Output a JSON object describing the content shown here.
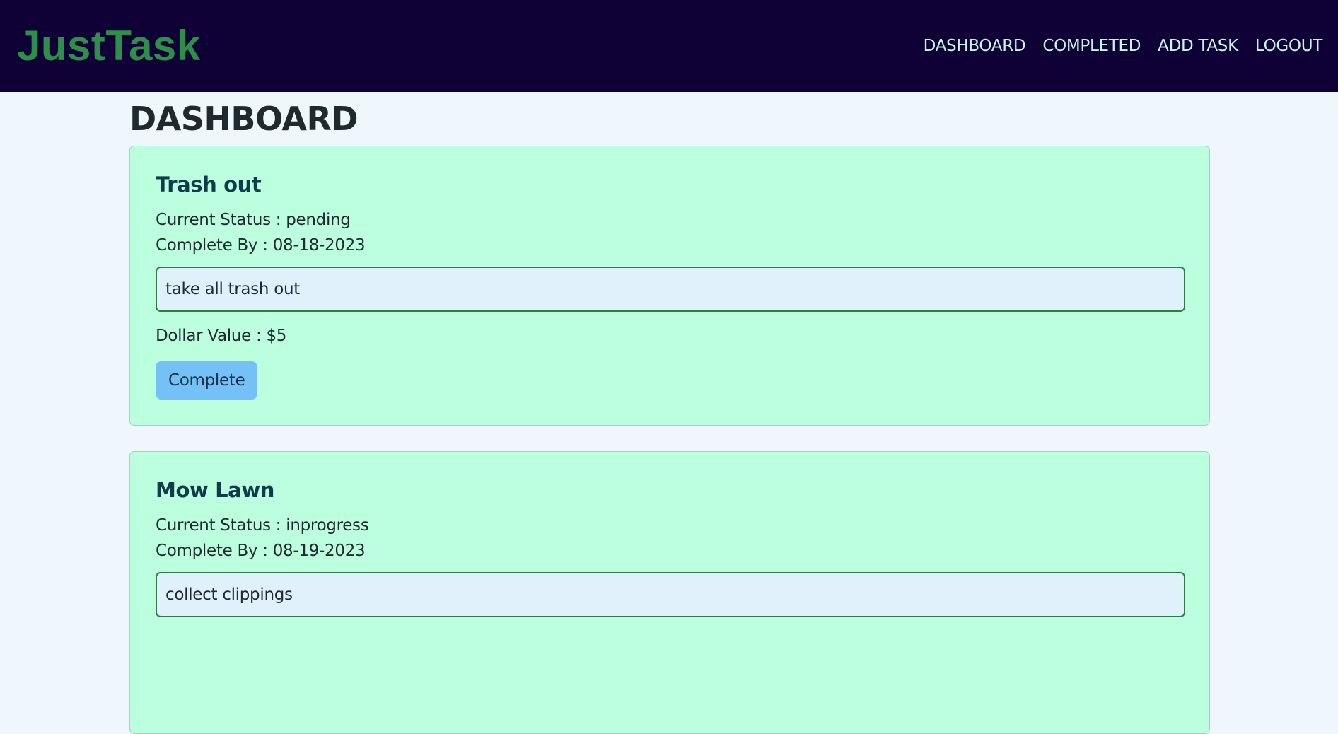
{
  "brand": {
    "name": "JustTask",
    "color": "#2e8f4a"
  },
  "nav": {
    "items": [
      {
        "label": "DASHBOARD"
      },
      {
        "label": "COMPLETED"
      },
      {
        "label": "ADD TASK"
      },
      {
        "label": "LOGOUT"
      }
    ],
    "background": "#0f0035",
    "link_color": "#c9f5ec"
  },
  "page": {
    "title": "DASHBOARD"
  },
  "tasks": [
    {
      "title": "Trash out",
      "status_text": "Current Status : pending",
      "complete_by_text": "Complete By : 08-18-2023",
      "description": "take all trash out",
      "value_text": "Dollar Value : $5",
      "button_label": "Complete"
    },
    {
      "title": "Mow Lawn",
      "status_text": "Current Status : inprogress",
      "complete_by_text": "Complete By : 08-19-2023",
      "description": "collect clippings"
    }
  ],
  "colors": {
    "page_bg": "#eff6fc",
    "card_bg": "#bbffdf",
    "button_bg": "#73c1f6",
    "input_bg": "#e0f1fb",
    "input_border": "#2f7a48"
  }
}
